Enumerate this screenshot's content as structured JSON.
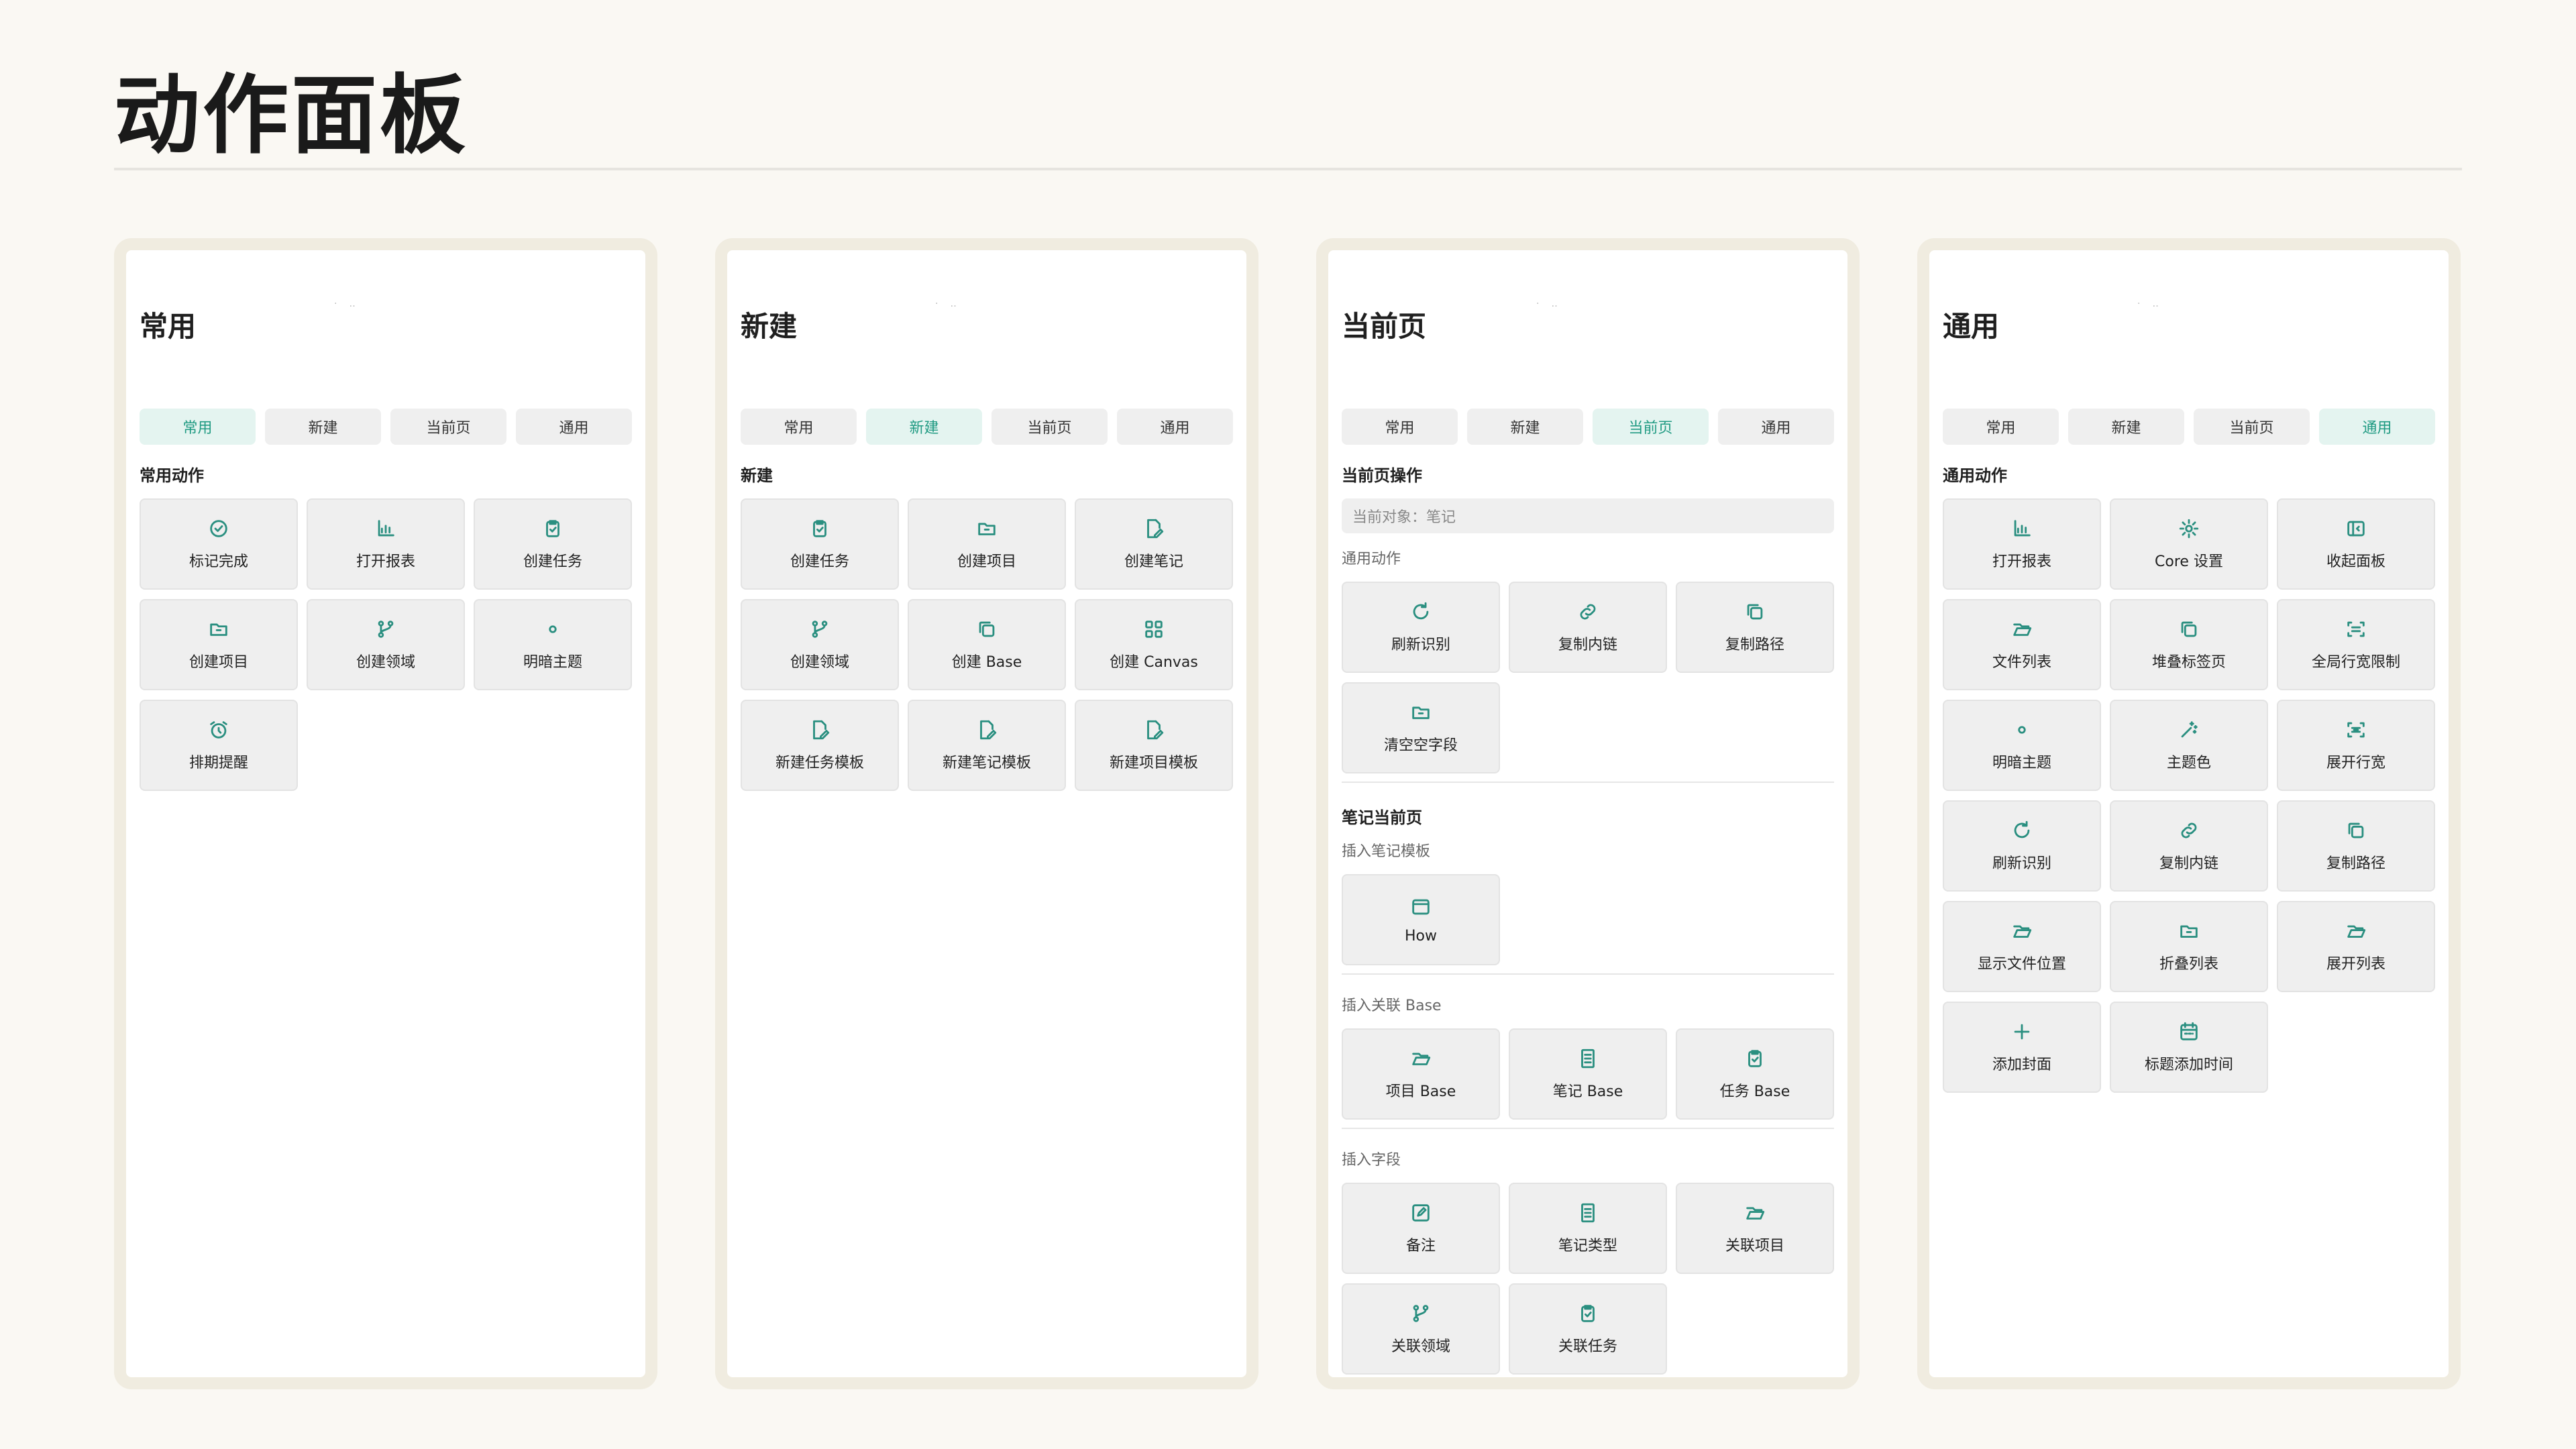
{
  "page": {
    "title": "动作面板"
  },
  "tabs": [
    "常用",
    "新建",
    "当前页",
    "通用"
  ],
  "panels": {
    "p1": {
      "heading": "常用",
      "section": "常用动作",
      "buttons": [
        {
          "label": "标记完成",
          "icon": "check-circle-icon"
        },
        {
          "label": "打开报表",
          "icon": "chart-icon"
        },
        {
          "label": "创建任务",
          "icon": "clipboard-check-icon"
        },
        {
          "label": "创建项目",
          "icon": "folder-icon"
        },
        {
          "label": "创建领域",
          "icon": "branch-icon"
        },
        {
          "label": "明暗主题",
          "icon": "dot-icon"
        },
        {
          "label": "排期提醒",
          "icon": "alarm-icon"
        }
      ]
    },
    "p2": {
      "heading": "新建",
      "section": "新建",
      "buttons": [
        {
          "label": "创建任务",
          "icon": "clipboard-check-icon"
        },
        {
          "label": "创建项目",
          "icon": "folder-icon"
        },
        {
          "label": "创建笔记",
          "icon": "file-pen-icon"
        },
        {
          "label": "创建领域",
          "icon": "branch-icon"
        },
        {
          "label": "创建 Base",
          "icon": "copy-icon"
        },
        {
          "label": "创建 Canvas",
          "icon": "grid-icon"
        },
        {
          "label": "新建任务模板",
          "icon": "file-pen-icon"
        },
        {
          "label": "新建笔记模板",
          "icon": "file-pen-icon"
        },
        {
          "label": "新建项目模板",
          "icon": "file-pen-icon"
        }
      ]
    },
    "p3": {
      "heading": "当前页",
      "section": "当前页操作",
      "context": "当前对象：笔记",
      "general_label": "通用动作",
      "general_buttons": [
        {
          "label": "刷新识别",
          "icon": "refresh-icon"
        },
        {
          "label": "复制内链",
          "icon": "link-icon"
        },
        {
          "label": "复制路径",
          "icon": "copy-icon"
        },
        {
          "label": "清空空字段",
          "icon": "folder-icon"
        }
      ],
      "note_section": "笔记当前页",
      "template_label": "插入笔记模板",
      "template_buttons": [
        {
          "label": "How",
          "icon": "window-icon"
        }
      ],
      "base_label": "插入关联 Base",
      "base_buttons": [
        {
          "label": "项目 Base",
          "icon": "folder-open-icon"
        },
        {
          "label": "笔记 Base",
          "icon": "document-icon"
        },
        {
          "label": "任务 Base",
          "icon": "clipboard-check-icon"
        }
      ],
      "field_label": "插入字段",
      "field_buttons": [
        {
          "label": "备注",
          "icon": "edit-box-icon"
        },
        {
          "label": "笔记类型",
          "icon": "document-icon"
        },
        {
          "label": "关联项目",
          "icon": "folder-open-icon"
        },
        {
          "label": "关联领域",
          "icon": "branch-icon"
        },
        {
          "label": "关联任务",
          "icon": "clipboard-check-icon"
        }
      ]
    },
    "p4": {
      "heading": "通用",
      "section": "通用动作",
      "buttons": [
        {
          "label": "打开报表",
          "icon": "chart-icon"
        },
        {
          "label": "Core 设置",
          "icon": "gear-icon"
        },
        {
          "label": "收起面板",
          "icon": "panel-collapse-icon"
        },
        {
          "label": "文件列表",
          "icon": "folder-open-icon"
        },
        {
          "label": "堆叠标签页",
          "icon": "copy-icon"
        },
        {
          "label": "全局行宽限制",
          "icon": "scan-icon"
        },
        {
          "label": "明暗主题",
          "icon": "dot-icon"
        },
        {
          "label": "主题色",
          "icon": "sparkle-wand-icon"
        },
        {
          "label": "展开行宽",
          "icon": "expand-lines-icon"
        },
        {
          "label": "刷新识别",
          "icon": "refresh-icon"
        },
        {
          "label": "复制内链",
          "icon": "link-icon"
        },
        {
          "label": "复制路径",
          "icon": "copy-icon"
        },
        {
          "label": "显示文件位置",
          "icon": "folder-open-icon"
        },
        {
          "label": "折叠列表",
          "icon": "folder-icon"
        },
        {
          "label": "展开列表",
          "icon": "folder-open-icon"
        },
        {
          "label": "添加封面",
          "icon": "plus-icon"
        },
        {
          "label": "标题添加时间",
          "icon": "calendar-icon"
        }
      ]
    }
  },
  "colors": {
    "accent": "#2a8f80",
    "active_tab_bg": "#e4f4f0",
    "page_bg": "#faf8f3",
    "panel_border": "#f0ece0"
  }
}
